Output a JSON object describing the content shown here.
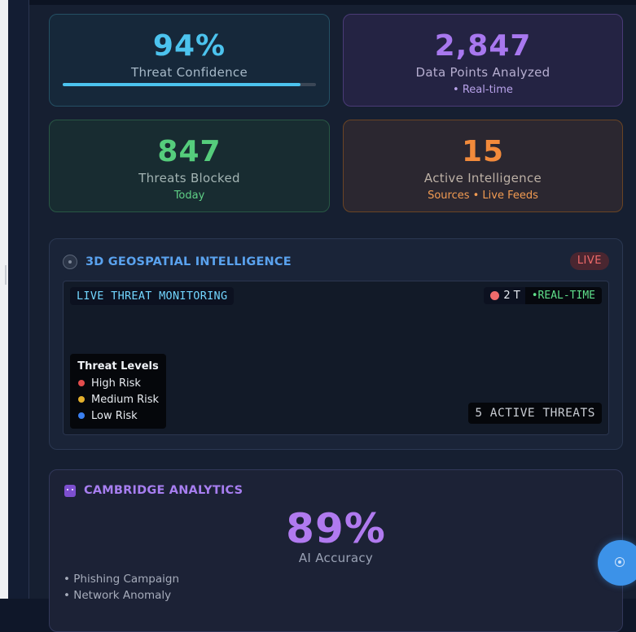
{
  "metrics": {
    "confidence": {
      "value": "94%",
      "label": "Threat Confidence",
      "progress_fraction": 0.94
    },
    "data_points": {
      "value": "2,847",
      "label": "Data Points Analyzed",
      "sub": "• Real-time"
    },
    "threats_blocked": {
      "value": "847",
      "label": "Threats Blocked",
      "sub": "Today"
    },
    "intelligence": {
      "value": "15",
      "label": "Active Intelligence",
      "sub": "Sources • Live Feeds"
    }
  },
  "geo": {
    "title": "3D GEOSPATIAL INTELLIGENCE",
    "badge": "LIVE",
    "map_tag": "LIVE THREAT MONITORING",
    "status_threats": "2 T",
    "status_realtime": "•REAL-TIME",
    "legend_title": "Threat Levels",
    "legend": [
      {
        "label": "High Risk",
        "color": "#e34d4d"
      },
      {
        "label": "Medium Risk",
        "color": "#e4b02d"
      },
      {
        "label": "Low Risk",
        "color": "#3a7ff0"
      }
    ],
    "active_threats": "5 ACTIVE THREATS"
  },
  "cambridge": {
    "title": "CAMBRIDGE ANALYTICS",
    "value": "89%",
    "label": "AI Accuracy",
    "items": [
      "• Phishing Campaign",
      "• Network Anomaly"
    ]
  },
  "icons": {
    "geo": "globe-icon",
    "cambridge": "robot-icon",
    "fab": "assistant-icon"
  },
  "colors": {
    "accent_cyan": "#4cc3ee",
    "accent_purple": "#a878ef",
    "accent_green": "#55cd7c",
    "accent_orange": "#f28a3b"
  }
}
